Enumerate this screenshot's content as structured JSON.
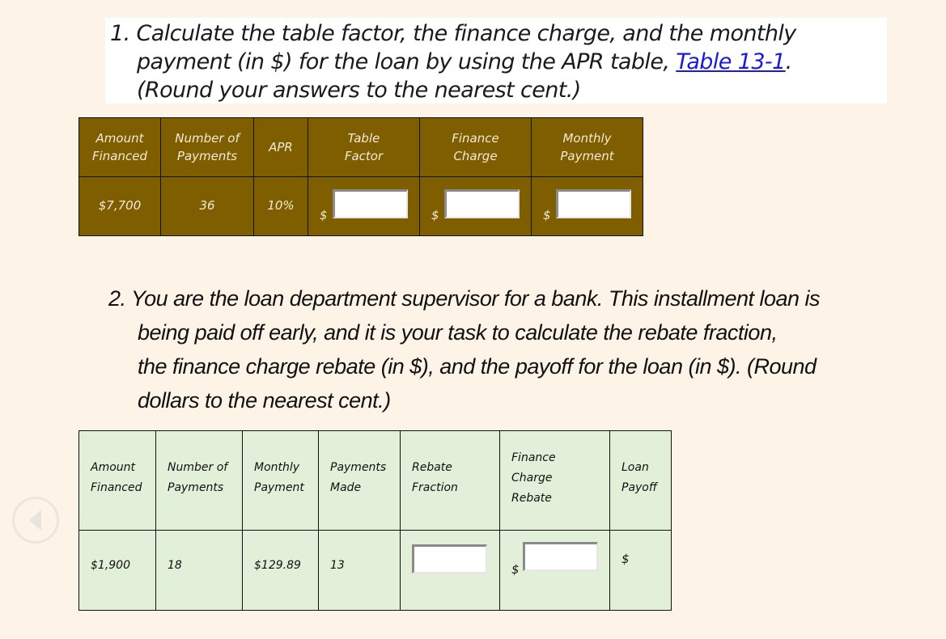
{
  "question1": {
    "number": "1.",
    "line1": "Calculate the table factor, the finance charge, and the monthly",
    "line2_prefix": "payment (in $) for the loan by using the APR table, ",
    "link_text": "Table 13-1",
    "line2_suffix": ".",
    "line3": "(Round your answers to the nearest cent.)"
  },
  "table1": {
    "headers": [
      {
        "line1": "Amount",
        "line2": "Financed"
      },
      {
        "line1": "Number of",
        "line2": "Payments"
      },
      {
        "line1": "APR",
        "line2": ""
      },
      {
        "line1": "Table",
        "line2": "Factor"
      },
      {
        "line1": "Finance",
        "line2": "Charge"
      },
      {
        "line1": "Monthly",
        "line2": "Payment"
      }
    ],
    "row": {
      "amount_financed": "$7,700",
      "number_of_payments": "36",
      "apr": "10%",
      "currency_symbol": "$",
      "table_factor_value": "",
      "finance_charge_value": "",
      "monthly_payment_value": ""
    }
  },
  "question2": {
    "number": "2.",
    "line1": "You are the loan department supervisor for a bank. This installment loan is",
    "line2": "being paid off early, and it is your task to calculate the rebate fraction,",
    "line3": "the finance charge rebate (in $), and the payoff for the loan (in $). (Round",
    "line4": "dollars to the nearest cent.)"
  },
  "table2": {
    "headers": [
      {
        "line1": "Amount",
        "line2": "Financed",
        "line3": ""
      },
      {
        "line1": "Number of",
        "line2": "Payments",
        "line3": ""
      },
      {
        "line1": "Monthly",
        "line2": "Payment",
        "line3": ""
      },
      {
        "line1": "Payments",
        "line2": "Made",
        "line3": ""
      },
      {
        "line1": "Rebate",
        "line2": "Fraction",
        "line3": ""
      },
      {
        "line1": "Finance",
        "line2": "Charge",
        "line3": "Rebate"
      },
      {
        "line1": "Loan",
        "line2": "Payoff",
        "line3": ""
      }
    ],
    "row": {
      "amount_financed": "$1,900",
      "number_of_payments": "18",
      "monthly_payment": "$129.89",
      "payments_made": "13",
      "rebate_fraction_value": "",
      "currency_symbol": "$",
      "finance_charge_rebate_value": "",
      "loan_payoff_symbol": "$"
    }
  },
  "navigation": {
    "back_icon": "previous-arrow-icon"
  }
}
